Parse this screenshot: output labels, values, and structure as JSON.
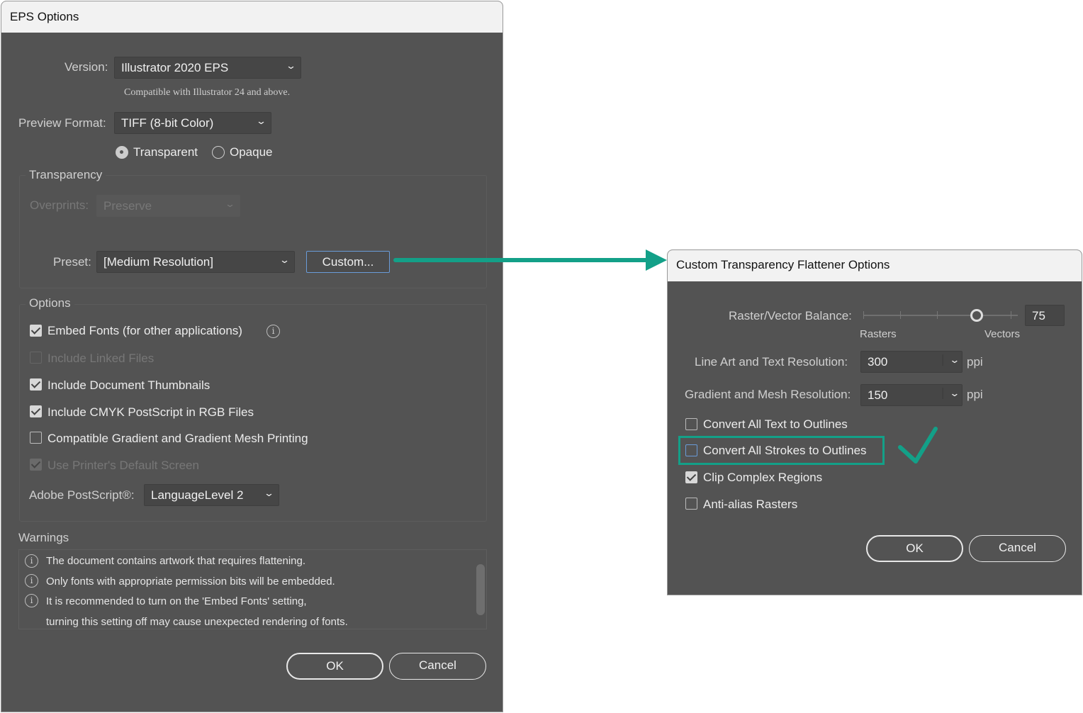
{
  "eps": {
    "title": "EPS Options",
    "version_label": "Version:",
    "version_value": "Illustrator 2020 EPS",
    "compat_note": "Compatible with Illustrator 24 and above.",
    "preview_label": "Preview Format:",
    "preview_value": "TIFF (8-bit Color)",
    "radio_transparent": "Transparent",
    "radio_opaque": "Opaque",
    "transparency_group": "Transparency",
    "overprints_label": "Overprints:",
    "overprints_value": "Preserve",
    "preset_label": "Preset:",
    "preset_value": "[Medium Resolution]",
    "custom_button": "Custom...",
    "options_group": "Options",
    "options": [
      {
        "label": "Embed Fonts (for other applications)",
        "checked": true,
        "enabled": true
      },
      {
        "label": "Include Linked Files",
        "checked": false,
        "enabled": false
      },
      {
        "label": "Include Document Thumbnails",
        "checked": true,
        "enabled": true
      },
      {
        "label": "Include CMYK PostScript in RGB Files",
        "checked": true,
        "enabled": true
      },
      {
        "label": "Compatible Gradient and Gradient Mesh Printing",
        "checked": false,
        "enabled": true
      },
      {
        "label": "Use Printer's Default Screen",
        "checked": true,
        "enabled": false
      }
    ],
    "postscript_label": "Adobe PostScript®:",
    "postscript_value": "LanguageLevel 2",
    "warnings_label": "Warnings",
    "warnings": [
      "The document contains artwork that requires flattening.",
      "Only fonts with appropriate permission bits will be embedded.",
      "It is recommended to turn on the 'Embed Fonts' setting,",
      "turning this setting off may cause unexpected rendering of fonts."
    ],
    "ok": "OK",
    "cancel": "Cancel"
  },
  "flat": {
    "title": "Custom Transparency Flattener Options",
    "balance_label": "Raster/Vector Balance:",
    "balance_value": "75",
    "rasters": "Rasters",
    "vectors": "Vectors",
    "lineart_label": "Line Art and Text Resolution:",
    "lineart_value": "300",
    "gradient_label": "Gradient and Mesh Resolution:",
    "gradient_value": "150",
    "ppi": "ppi",
    "options": [
      {
        "label": "Convert All Text to Outlines",
        "checked": false
      },
      {
        "label": "Convert All Strokes to Outlines",
        "checked": false
      },
      {
        "label": "Clip Complex Regions",
        "checked": true
      },
      {
        "label": "Anti-alias Rasters",
        "checked": false
      }
    ],
    "ok": "OK",
    "cancel": "Cancel"
  },
  "accent": "#13a088"
}
